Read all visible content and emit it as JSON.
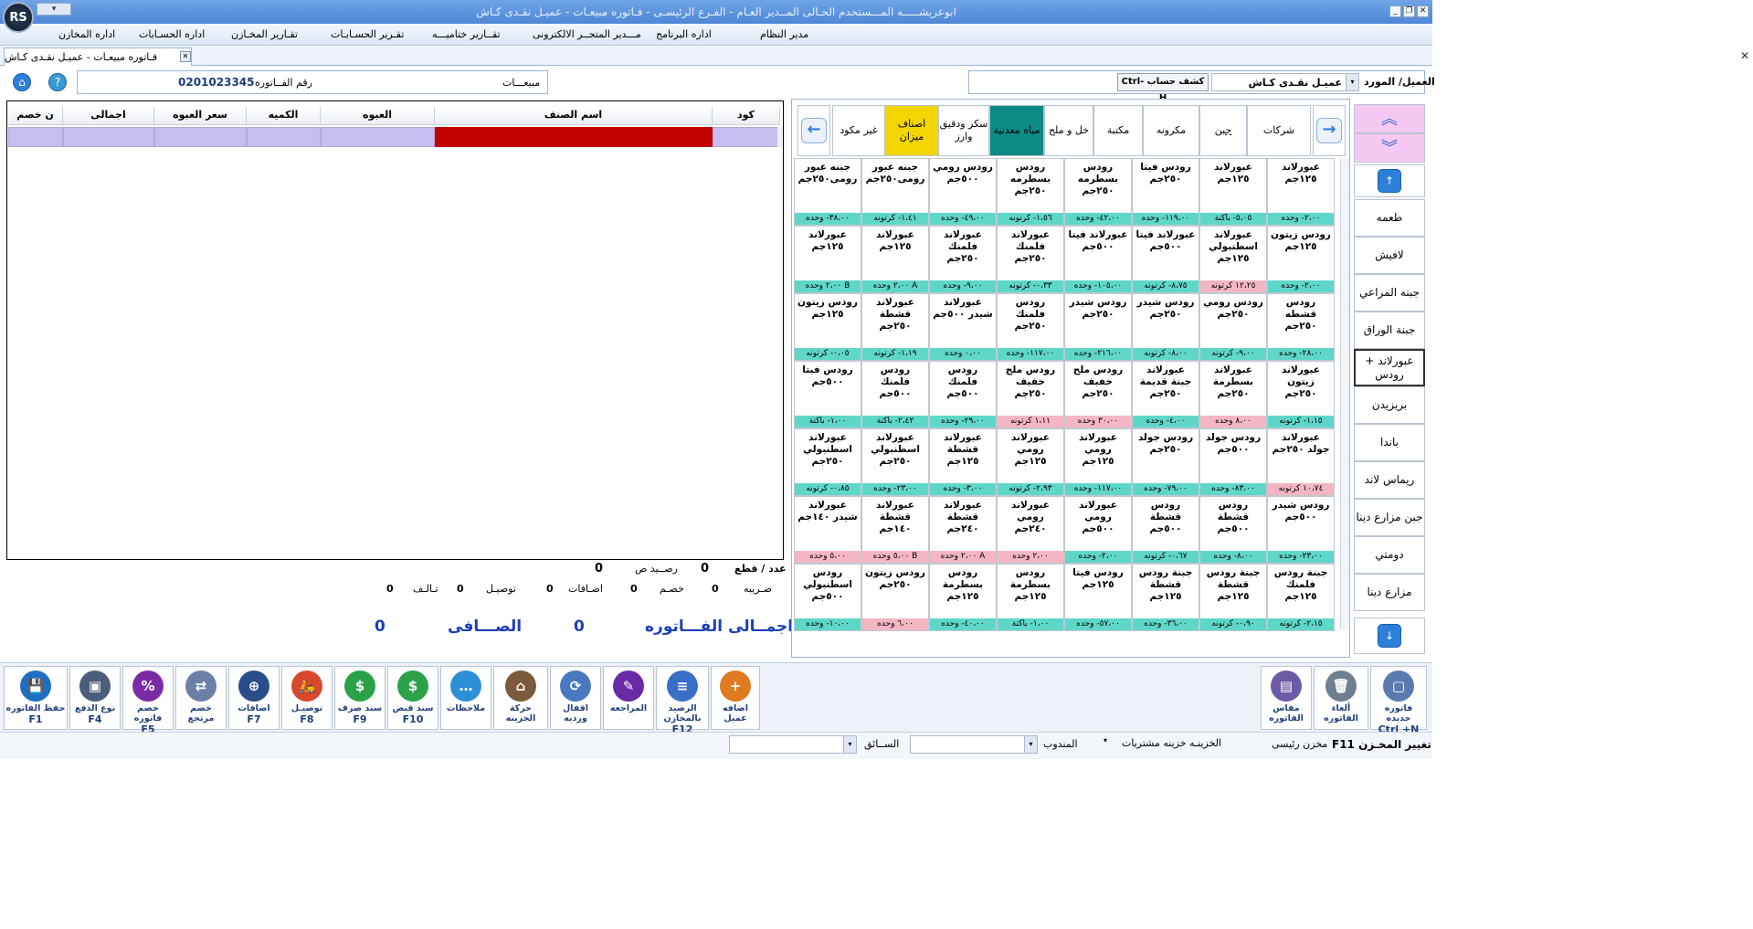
{
  "window": {
    "title": "ابوعريشـــــه المـــستخدم الحـالى المــدير العـام   -  الفـرع الرئيسـى   -  فـاتوره مبيعـات  -  عميـل نقـدى كـاش",
    "logo": "RS"
  },
  "menu": [
    "مدير النظام",
    "اداره البرنامج",
    "مـــدير المتجــر الالكترونى",
    "تقــارير ختاميـــه",
    "تقـرير الحسـابـات",
    "تقـارير المخـازن",
    "اداره الحسـابات",
    "اداره المخازن"
  ],
  "doc_tab": "فـاتوره مبيعـات  -  عميـل نقـدى كـاش",
  "info": {
    "invoice_no_label": "رقم الفــاتوره",
    "invoice_no": "0201023345",
    "type": "مبيعـــات",
    "customer_label": "العميل/ المورد",
    "customer": "عميـل نقـدى كـاش",
    "statement_btn": "كشف حساب Ctrl-H"
  },
  "grid": {
    "headers": [
      "كود",
      "اسم الصنف",
      "العبوه",
      "الكميه",
      "سعر العبوه",
      "اجمالى",
      "ن خصم"
    ]
  },
  "totals": {
    "count_label": "عدد / قطع",
    "count": "0",
    "balance_label": "رصــيد ص",
    "balance": "0",
    "tax_label": "ضـريبه",
    "tax": "0",
    "discount_label": "خصـم",
    "discount": "0",
    "additions_label": "اضـافات",
    "additions": "0",
    "delivery_label": "توصيـل",
    "delivery": "0",
    "damage_label": "تـالـف",
    "damage": "0",
    "invoice_total_label": "اجمــالى الفـــاتوره",
    "invoice_total": "0",
    "net_label": "الصـــافى",
    "net": "0"
  },
  "categories": [
    "شركات",
    "جبن",
    "مكرونه",
    "مكتبة",
    "خل و ملح",
    "مياه معدنية",
    "سكر ودقيق وارز",
    "اصناف ميزان",
    "غير مكود"
  ],
  "products": [
    [
      "عبورلاند ١٢٥جم",
      "٢،٠٠- وحده",
      "c"
    ],
    [
      "عبورلاند ١٢٥جم",
      "٥،٠٥- باكتة",
      "c"
    ],
    [
      "رودس فيتا ٢٥٠جم",
      "١١٩،٠٠- وحده",
      "c"
    ],
    [
      "رودس بسطرمه ٢٥٠جم",
      "٤٢،٠٠- وحده",
      "c"
    ],
    [
      "رودس بسطرمه ٢٥٠جم",
      "١،٥٦- كرتونه",
      "c"
    ],
    [
      "رودس رومي ٥٠٠جم",
      "٤٩،٠٠- وحده",
      "c"
    ],
    [
      "جبنه عبور رومى٢٥٠جم",
      "١،٤١- كرتونه",
      "c"
    ],
    [
      "جبنه عبور رومى٢٥٠جم",
      "٣٨،٠٠- وحده",
      "c"
    ],
    [
      "رودس زيتون ١٢٥جم",
      "٢،٠٠- وحده",
      "c"
    ],
    [
      "عبورلاند اسطنبولي ١٢٥جم",
      "١٢،٢٥ كرتونه",
      "p"
    ],
    [
      "عبورلاند فيتا ٥٠٠جم",
      "٨،٧٥- كرتونه",
      "c"
    ],
    [
      "عبورلاند فيتا ٥٠٠جم",
      "١٠٥،٠٠- وحده",
      "c"
    ],
    [
      "عبورلاند فلمنك ٢٥٠جم",
      "٠،٣٣- كرتونه",
      "c"
    ],
    [
      "عبورلاند فلمنك ٢٥٠جم",
      "٩،٠٠- وحده",
      "c"
    ],
    [
      "عبورلاند ١٢٥جم",
      "A ٢،٠٠ وحده",
      "c"
    ],
    [
      "عبورلاند ١٢٥جم",
      "B ٢،٠٠ وحده",
      "c"
    ],
    [
      "رودس قشطه ٢٥٠جم",
      "٢٨،٠٠- وحده",
      "c"
    ],
    [
      "رودس رومي ٢٥٠جم",
      "٩،٠٠- كرتونه",
      "c"
    ],
    [
      "رودس شيدر ٢٥٠جم",
      "٨،٠٠- كرتونه",
      "c"
    ],
    [
      "رودس شيدر ٢٥٠جم",
      "٢١٦،٠٠- وحده",
      "c"
    ],
    [
      "رودس فلمنك ٢٥٠جم",
      "١١٧،٠٠- وحده",
      "c"
    ],
    [
      "عبورلاند شيدر ٥٠٠جم",
      "٠،٠٠ وحده",
      "c"
    ],
    [
      "عبورلاند قشطة ٢٥٠جم",
      "١،١٩- كرتونه",
      "c"
    ],
    [
      "رودس زيتون ١٢٥جم",
      "٠،٠٥- كرتونه",
      "c"
    ],
    [
      "عبورلاند زيتون ٢٥٠جم",
      "١،١٥- كرتونه",
      "c"
    ],
    [
      "عبورلاند بسطرمة ٢٥٠جم",
      "٨،٠٠ وحده",
      "p"
    ],
    [
      "عبورلاند جبنة قديمة ٢٥٠جم",
      "٤،٠٠- وحده",
      "c"
    ],
    [
      "رودس ملح خفيف ٢٥٠جم",
      "٣٠،٠٠ وحده",
      "p"
    ],
    [
      "رودس ملح خفيف ٢٥٠جم",
      "١،١١ كرتونه",
      "p"
    ],
    [
      "رودس فلمنك ٥٠٠جم",
      "٢٩،٠٠- وحده",
      "c"
    ],
    [
      "رودس فلمنك ٥٠٠جم",
      "٢،٤٢- باكتة",
      "c"
    ],
    [
      "رودس فيتا ٥٠٠جم",
      "١،٠٠- باكتة",
      "c"
    ],
    [
      "عبورلاند جولد ٢٥٠جم",
      "١٠،٧٤ كرتونه",
      "p"
    ],
    [
      "رودس جولد ٥٠٠جم",
      "٨٣،٠٠- وحده",
      "c"
    ],
    [
      "رودس جولد ٢٥٠جم",
      "٧٩،٠٠- وحده",
      "c"
    ],
    [
      "عبورلاند رومي ١٢٥جم",
      "١١٧،٠٠- وحده",
      "c"
    ],
    [
      "عبورلاند رومي ١٢٥جم",
      "٢،٩٣- كرتونه",
      "c"
    ],
    [
      "عبورلاند قشطة ١٢٥جم",
      "٣،٠٠- وحده",
      "c"
    ],
    [
      "عبورلاند اسطنبولي ٢٥٠جم",
      "٢٣،٠٠- وحده",
      "c"
    ],
    [
      "عبورلاند اسطنبولي ٢٥٠جم",
      "٠،٨٥- كرتونه",
      "c"
    ],
    [
      "رودس شيدر ٥٠٠جم",
      "٢٣،٠٠- وحده",
      "c"
    ],
    [
      "رودس قشطة ٥٠٠جم",
      "٨،٠٠- وحده",
      "c"
    ],
    [
      "رودس قشطة ٥٠٠جم",
      "٠،٦٧- كرتونه",
      "c"
    ],
    [
      "عبورلاند رومي ٥٠٠جم",
      "٢،٠٠- وحده",
      "c"
    ],
    [
      "عبورلاند رومي ٢٤٠جم",
      "٢،٠٠ وحده",
      "p"
    ],
    [
      "عبورلاند قشطة ٢٤٠جم",
      "A ٢،٠٠ وحده",
      "p"
    ],
    [
      "عبورلاند قشطة ١٤٠جم",
      "B ٥،٠٠ وحده",
      "p"
    ],
    [
      "عبورلاند شيدر ١٤٠جم",
      "٥،٠٠ وحده",
      "p"
    ],
    [
      "جبنة رودس فلمنك ١٢٥جم",
      "٢،١٥- كرتونه",
      "c"
    ],
    [
      "جبنة رودس قشطة ١٢٥جم",
      "٠،٩٠- كرتونه",
      "c"
    ],
    [
      "جبنة رودس قشطة ١٢٥جم",
      "٣٦،٠٠- وحده",
      "c"
    ],
    [
      "رودس فيتا ١٢٥جم",
      "٥٧،٠٠- وحده",
      "c"
    ],
    [
      "رودس بسطرمة ١٢٥جم",
      "١،٠٠- باكتة",
      "c"
    ],
    [
      "رودس بسطرمة ١٢٥جم",
      "٤٠،٠٠- وحده",
      "c"
    ],
    [
      "رودس زيتون ٢٥٠جم",
      "٦،٠٠ وحده",
      "p"
    ],
    [
      "رودس اسطنبولي ٥٠٠جم",
      "١٠،٠٠- وحده",
      "c"
    ]
  ],
  "side_categories": [
    "طعمه",
    "لافيش",
    "جبنه المراعي",
    "جبنة الوراق",
    "عبورلاند + رودس",
    "بريزيدن",
    "باندا",
    "ريماس لاند",
    "جبن مزارع دينا",
    "دومتي",
    "مزارع دينا"
  ],
  "toolbar": [
    {
      "label": "حفظ الفاتوره",
      "key": "F1",
      "icon": "save-icon"
    },
    {
      "label": "نوع الدفع",
      "key": "F4",
      "icon": "wallet-icon"
    },
    {
      "label": "خصم فاتوره",
      "key": "F5",
      "icon": "percent-icon"
    },
    {
      "label": "خصم مرتجع",
      "key": "",
      "icon": "return-icon"
    },
    {
      "label": "اضافات",
      "key": "F7",
      "icon": "add-icon"
    },
    {
      "label": "توصيـل",
      "key": "F8",
      "icon": "delivery-icon"
    },
    {
      "label": "سند صرف",
      "key": "F9",
      "icon": "payment-voucher-icon"
    },
    {
      "label": "سند قبض",
      "key": "F10",
      "icon": "receipt-voucher-icon"
    },
    {
      "label": "ملاحظات",
      "key": "",
      "icon": "notes-icon"
    },
    {
      "label": "حركة الخزينه",
      "key": "",
      "icon": "cashier-icon"
    },
    {
      "label": "اقفال ورديه",
      "key": "",
      "icon": "shift-icon"
    },
    {
      "label": "المراجعه",
      "key": "",
      "icon": "review-icon"
    },
    {
      "label": "الرصيد بالمخازن",
      "key": "F12",
      "icon": "stock-icon"
    },
    {
      "label": "اضافه عميل",
      "key": "",
      "icon": "add-customer-icon"
    },
    {
      "label": "مقاس الفاتوره",
      "key": "",
      "icon": "invoice-size-icon"
    },
    {
      "label": "ألغاء الفاتوره",
      "key": "",
      "icon": "trash-icon"
    },
    {
      "label": "فاتوره جديده",
      "key": "Ctrl +N",
      "icon": "new-invoice-icon"
    }
  ],
  "status": {
    "change_store": "تغيير المخـزن F11",
    "store": "مخزن رئيسى",
    "safe": "الخزينـه خزينه مشتريات",
    "rep_label": "المندوب",
    "driver_label": "الســائق"
  }
}
